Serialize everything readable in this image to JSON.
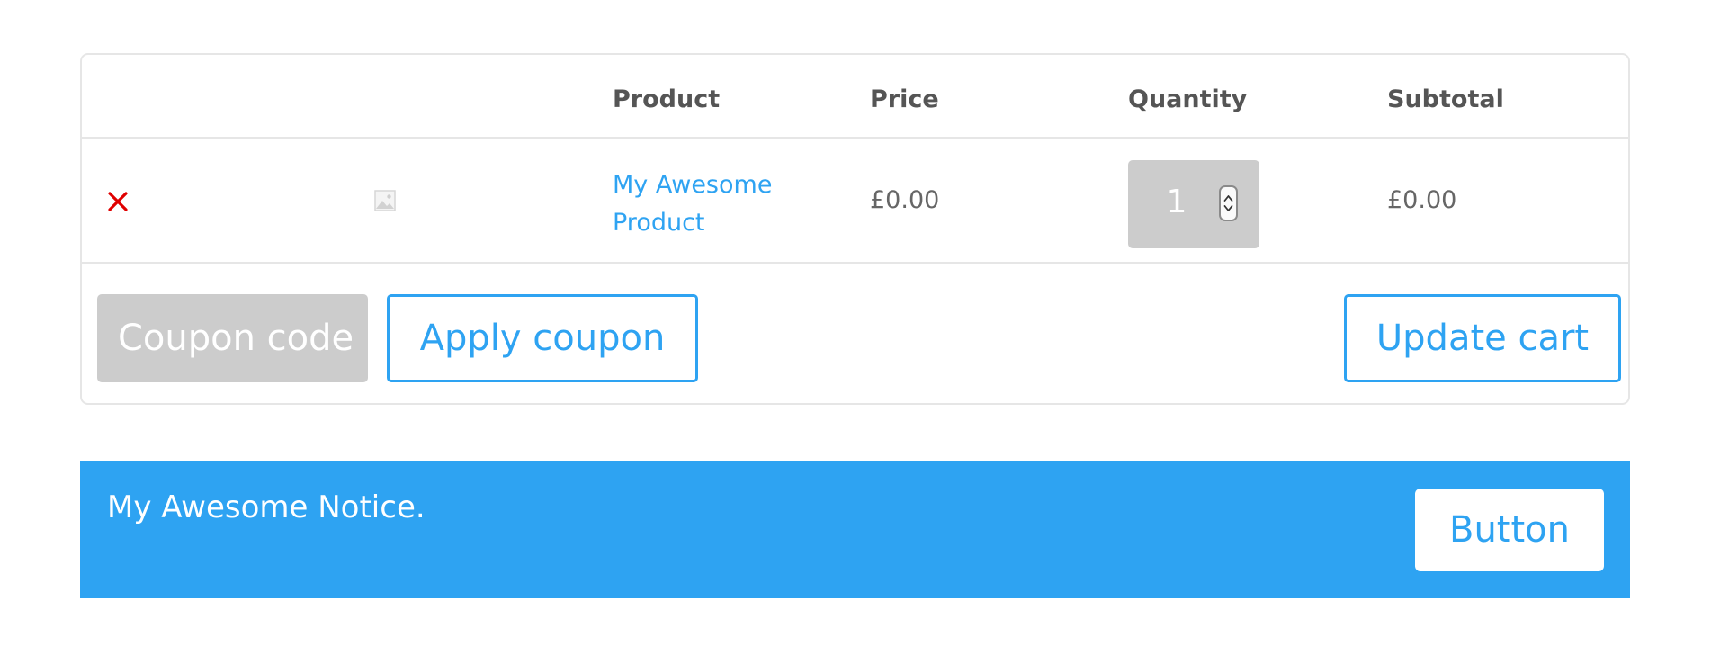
{
  "cart": {
    "headers": {
      "product": "Product",
      "price": "Price",
      "quantity": "Quantity",
      "subtotal": "Subtotal"
    },
    "items": [
      {
        "remove_icon": "close-icon",
        "thumbnail_icon": "image-placeholder-icon",
        "product_name": "My Awesome Product",
        "price": "£0.00",
        "quantity": "1",
        "subtotal": "£0.00"
      }
    ],
    "coupon": {
      "placeholder": "Coupon code",
      "value": ""
    },
    "apply_coupon_label": "Apply coupon",
    "update_cart_label": "Update cart"
  },
  "notice": {
    "text": "My Awesome Notice.",
    "button_label": "Button"
  },
  "colors": {
    "accent": "#2ea3f2",
    "remove": "#e00000",
    "input_bg": "#cccccc",
    "border": "#e6e6e6"
  }
}
